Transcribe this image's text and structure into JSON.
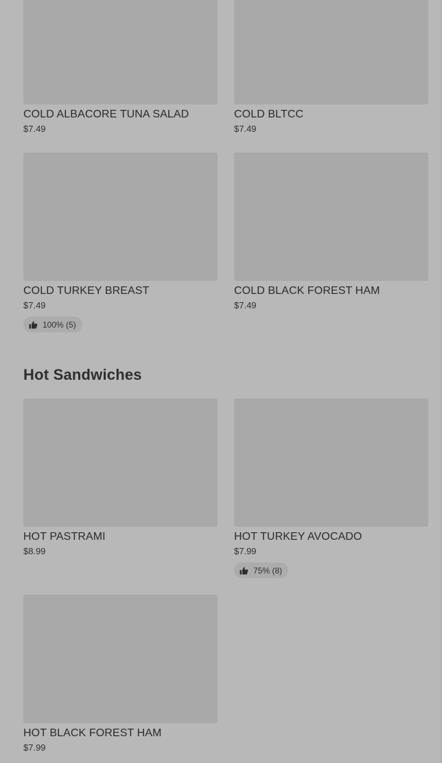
{
  "items": {
    "tuna": {
      "name": "COLD ALBACORE TUNA SALAD",
      "price": "$7.49"
    },
    "bltcc": {
      "name": "COLD BLTCC",
      "price": "$7.49"
    },
    "turkey_breast": {
      "name": "COLD TURKEY BREAST",
      "price": "$7.49",
      "rating": "100% (5)"
    },
    "black_forest_cold": {
      "name": "COLD BLACK FOREST HAM",
      "price": "$7.49"
    },
    "pastrami": {
      "name": "HOT PASTRAMI",
      "price": "$8.99"
    },
    "turkey_avocado": {
      "name": "HOT TURKEY AVOCADO",
      "price": "$7.99",
      "rating": "75% (8)"
    },
    "black_forest_hot": {
      "name": "HOT BLACK FOREST HAM",
      "price": "$7.99"
    }
  },
  "sections": {
    "hot_title": "Hot Sandwiches"
  },
  "icons": {
    "rating": "thumbs-up-icon"
  },
  "colors": {
    "background": "#b8b8b8",
    "image_placeholder": "#a9a9a9",
    "badge_bg": "#acacac",
    "text": "#2a2a2a"
  }
}
